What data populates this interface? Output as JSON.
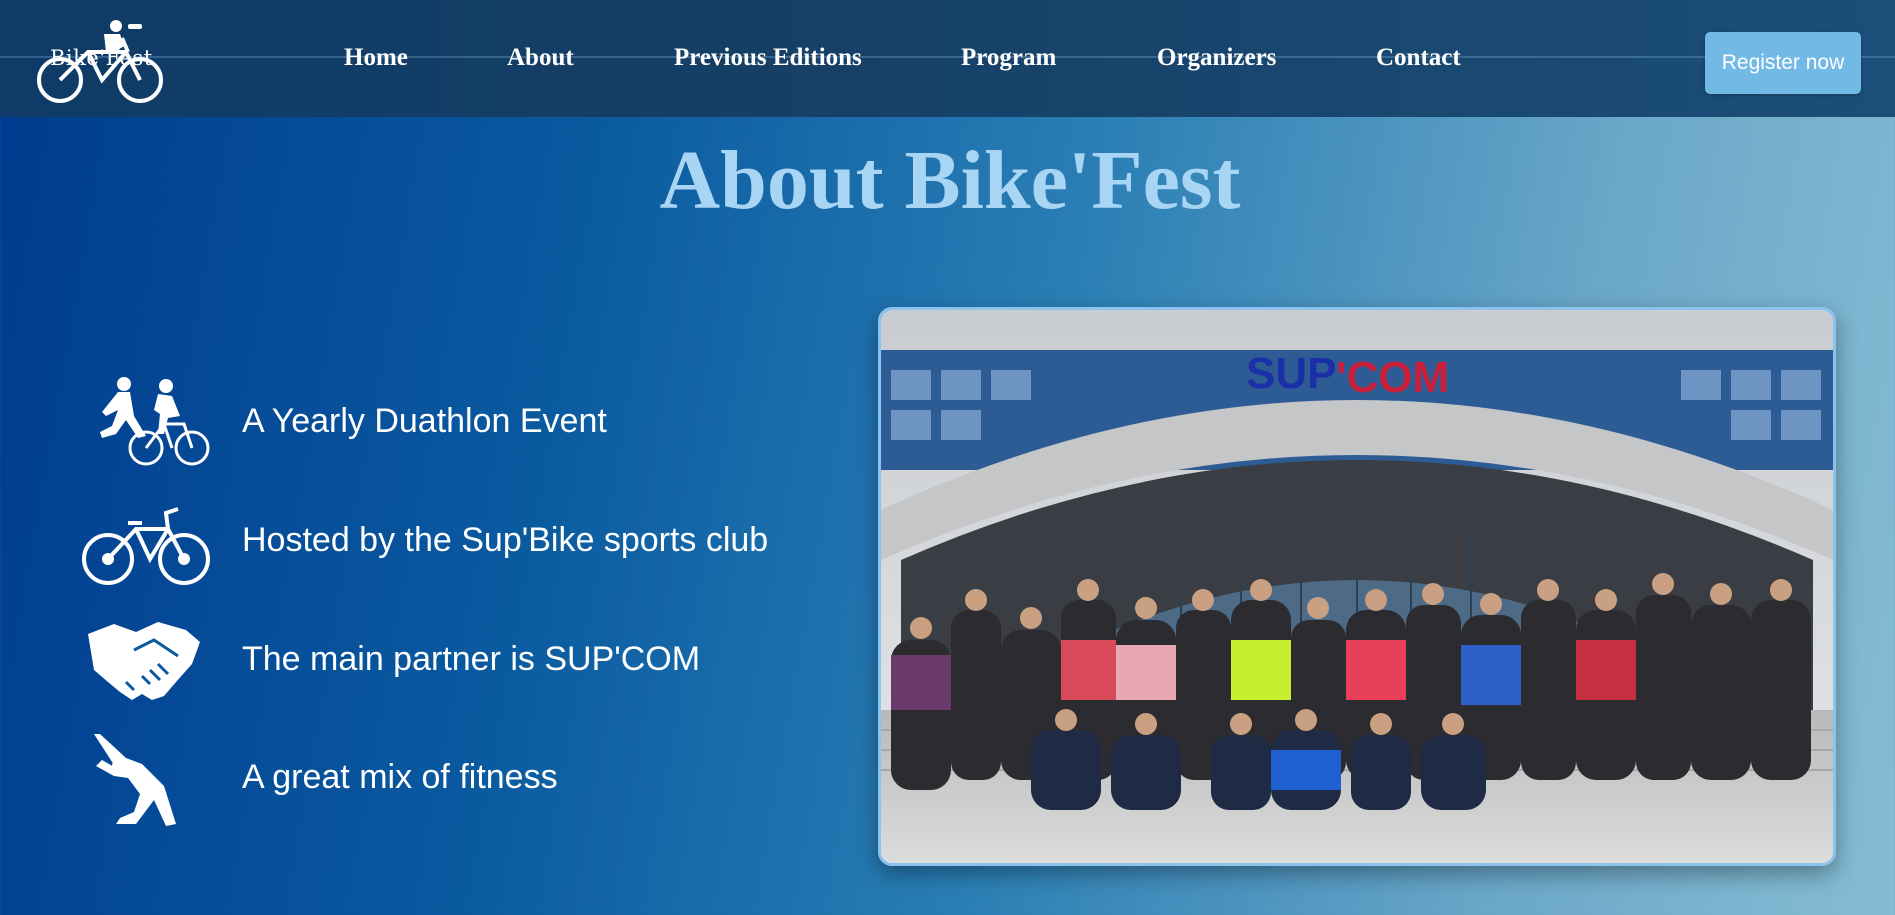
{
  "brand": {
    "logo_text": "Bike'Fest",
    "logo_icon": "bicycle-rider-icon"
  },
  "nav": {
    "items": [
      {
        "label": "Home"
      },
      {
        "label": "About"
      },
      {
        "label": "Previous Editions"
      },
      {
        "label": "Program"
      },
      {
        "label": "Organizers"
      },
      {
        "label": "Contact"
      }
    ],
    "register_label": "Register now"
  },
  "about": {
    "title": "About Bike'Fest",
    "features": [
      {
        "icon": "duathlon-runner-cyclist-icon",
        "text": "A Yearly Duathlon Event"
      },
      {
        "icon": "bicycle-icon",
        "text": "Hosted by the Sup'Bike sports club"
      },
      {
        "icon": "handshake-icon",
        "text": "The main partner is SUP'COM"
      },
      {
        "icon": "stretching-person-icon",
        "text": "A great mix of fitness"
      }
    ],
    "photo": {
      "sign_text_blue": "SUP",
      "sign_text_red": "'COM"
    }
  },
  "colors": {
    "nav_bg": "#163f66",
    "register_bg": "#72b9e6",
    "heading": "#a9d5f4",
    "photo_border": "#8cc3ee"
  }
}
